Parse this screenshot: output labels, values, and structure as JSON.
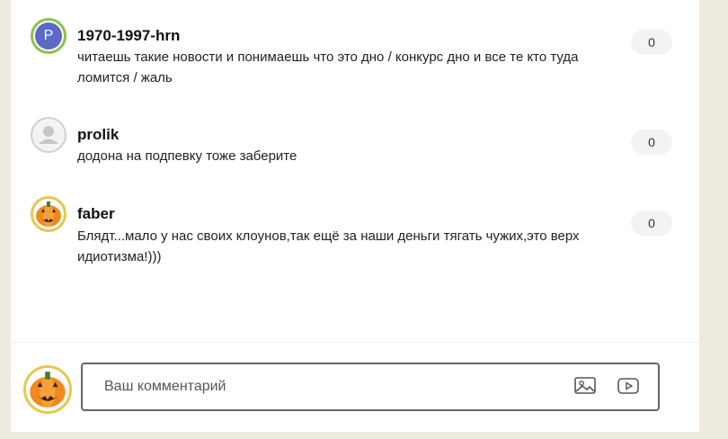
{
  "comments": [
    {
      "username": "1970-1997-hrn",
      "avatar_letter": "P",
      "text": "читаешь такие новости и понимаешь что это дно / конкурс дно и все те кто туда ломится / жаль",
      "likes": "0"
    },
    {
      "username": "prolik",
      "text": "додона на подпевку тоже заберите",
      "likes": "0"
    },
    {
      "username": "faber",
      "text": "Блядт...мало у нас своих клоунов,так ещё за наши деньги тягать чужих,это верх идиотизма!)))",
      "likes": "0"
    }
  ],
  "composer": {
    "placeholder": "Ваш комментарий",
    "image_icon": "image-icon",
    "video_icon": "youtube-icon"
  },
  "colors": {
    "avatar_letter_bg": "#5b6ac6",
    "avatar_ring_green": "#8bc34a",
    "pumpkin": "#f08a1c",
    "page_bg": "#efeadf"
  }
}
